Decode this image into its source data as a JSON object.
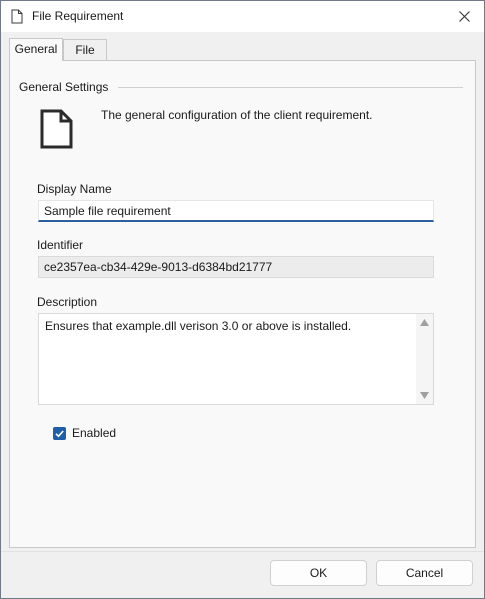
{
  "window": {
    "title": "File Requirement",
    "title_icon": "document-icon",
    "close_icon": "close-icon"
  },
  "tabs": [
    {
      "label": "General",
      "active": true
    },
    {
      "label": "File",
      "active": false
    }
  ],
  "general": {
    "section_title": "General Settings",
    "section_icon": "document-icon",
    "description": "The general configuration of the client requirement.",
    "display_name": {
      "label": "Display Name",
      "value": "Sample file requirement"
    },
    "identifier": {
      "label": "Identifier",
      "value": "ce2357ea-cb34-429e-9013-d6384bd21777"
    },
    "desc_field": {
      "label": "Description",
      "value": "Ensures that example.dll verison 3.0 or above is installed."
    },
    "enabled": {
      "label": "Enabled",
      "checked": true
    }
  },
  "buttons": {
    "ok": "OK",
    "cancel": "Cancel"
  },
  "colors": {
    "accent": "#1f5ea8",
    "titlebar": "#ffffff",
    "background": "#f0f0f0"
  }
}
